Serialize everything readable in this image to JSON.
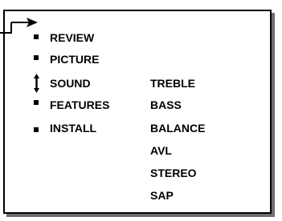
{
  "menu": {
    "items": [
      {
        "id": "review",
        "label": "REVIEW",
        "icon": "bullet-icon"
      },
      {
        "id": "picture",
        "label": "PICTURE",
        "icon": "bullet-icon"
      },
      {
        "id": "sound",
        "label": "SOUND",
        "icon": "up-down-arrow-icon"
      },
      {
        "id": "features",
        "label": "FEATURES",
        "icon": "bullet-icon"
      },
      {
        "id": "install",
        "label": "INSTALL",
        "icon": "bullet-icon"
      }
    ]
  },
  "submenu": {
    "items": [
      "TREBLE",
      "BASS",
      "BALANCE",
      "AVL",
      "STEREO",
      "SAP"
    ]
  },
  "colors": {
    "frame": "#000000",
    "shadow": "#6e6e6e",
    "text": "#000000",
    "background": "#ffffff"
  }
}
